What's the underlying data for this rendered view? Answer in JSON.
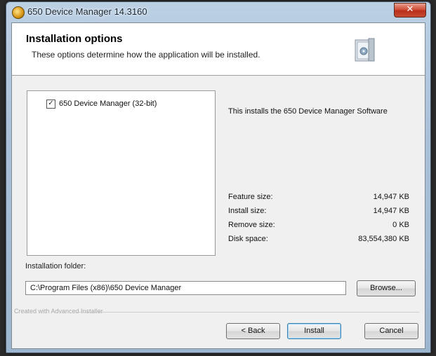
{
  "window": {
    "title": "650 Device Manager 14.3160",
    "close_label": "✕"
  },
  "header": {
    "title": "Installation options",
    "subtitle": "These options determine how the application will be installed."
  },
  "tree": {
    "items": [
      {
        "label": "650 Device Manager (32-bit)",
        "checked": true,
        "check_glyph": "☑"
      }
    ]
  },
  "description": "This installs the 650 Device Manager Software",
  "stats": [
    {
      "label": "Feature size:",
      "value": "14,947 KB"
    },
    {
      "label": "Install size:",
      "value": "14,947 KB"
    },
    {
      "label": "Remove size:",
      "value": "0 KB"
    },
    {
      "label": "Disk space:",
      "value": "83,554,380 KB"
    }
  ],
  "folder": {
    "label": "Installation folder:",
    "value": "C:\\Program Files (x86)\\650 Device Manager"
  },
  "buttons": {
    "browse": "Browse...",
    "back": "< Back",
    "install": "Install",
    "cancel": "Cancel"
  },
  "footer": {
    "brand": "Created with Advanced Installer"
  },
  "colors": {
    "accent_border": "#3c7fb1",
    "close_red": "#c84a30"
  },
  "icons": [
    "app-icon",
    "close-icon",
    "setup-box-icon",
    "checkbox-icon"
  ]
}
